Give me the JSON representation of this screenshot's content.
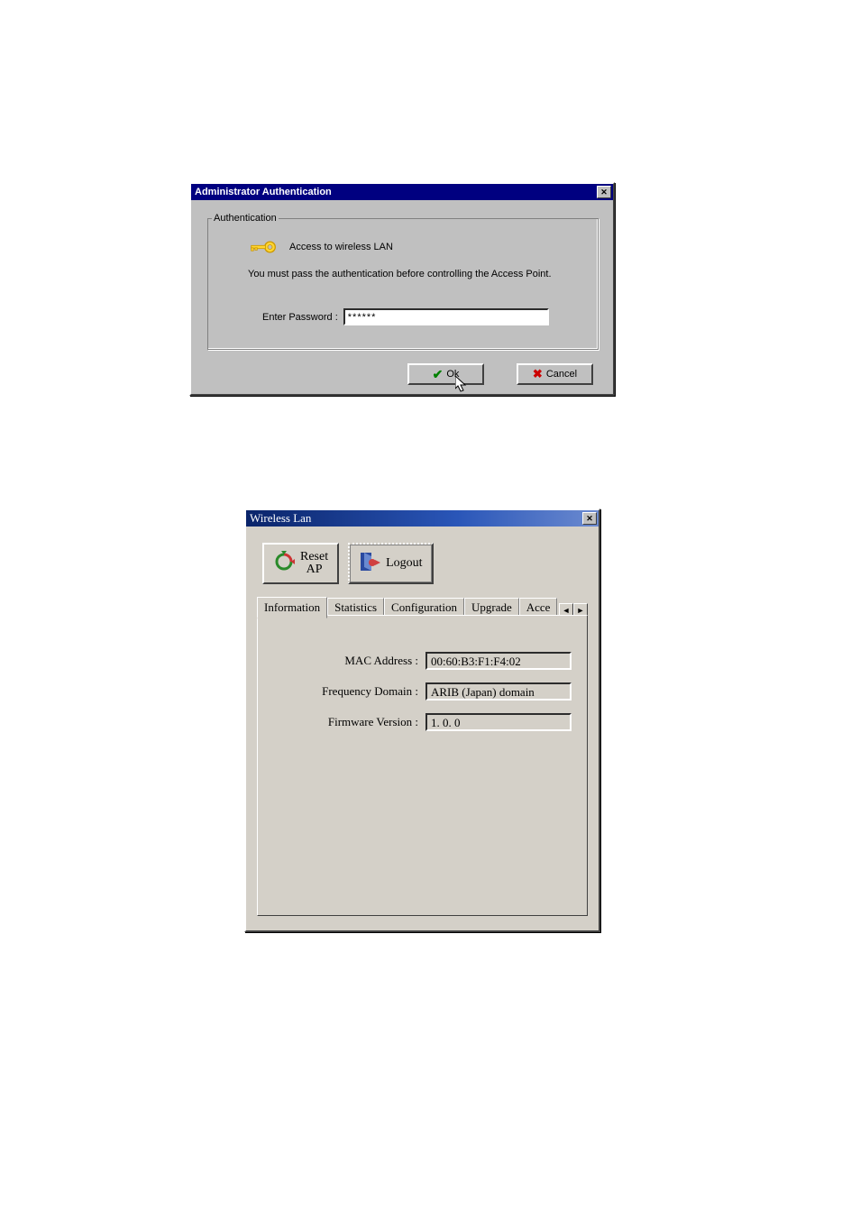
{
  "auth_dialog": {
    "title": "Administrator Authentication",
    "legend": "Authentication",
    "access_label": "Access to wireless LAN",
    "description": "You must pass the authentication before controlling the Access Point.",
    "password_label": "Enter Password :",
    "password_value": "******",
    "ok_label": "Ok",
    "cancel_label": "Cancel"
  },
  "wlan_dialog": {
    "title": "Wireless Lan",
    "reset_label": "Reset\nAP",
    "logout_label": "Logout",
    "tabs": {
      "information": "Information",
      "statistics": "Statistics",
      "configuration": "Configuration",
      "upgrade": "Upgrade",
      "access": "Acce"
    },
    "info": {
      "mac_label": "MAC Address :",
      "mac_value": "00:60:B3:F1:F4:02",
      "freq_label": "Frequency Domain :",
      "freq_value": "ARIB (Japan) domain",
      "fw_label": "Firmware Version :",
      "fw_value": "1. 0. 0"
    }
  }
}
